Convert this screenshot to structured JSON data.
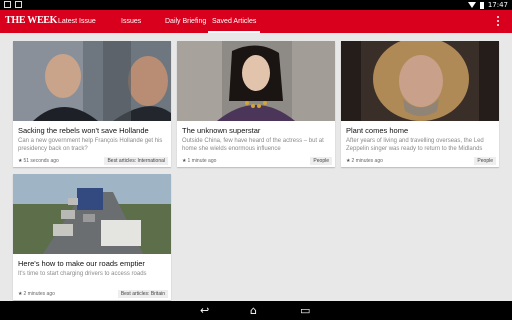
{
  "status": {
    "time": "17:47"
  },
  "app": {
    "logo": "THE WEEK"
  },
  "tabs": [
    {
      "label": "Latest Issue"
    },
    {
      "label": "Issues"
    },
    {
      "label": "Daily Briefing"
    },
    {
      "label": "Saved Articles",
      "active": true
    }
  ],
  "articles": [
    {
      "title": "Sacking the rebels won't save Hollande",
      "summary": "Can a new government help François Hollande get his presidency back on track?",
      "time": "51 seconds ago",
      "tag": "Best articles: International"
    },
    {
      "title": "The unknown superstar",
      "summary": "Outside China, few have heard of the actress – but at home she wields enormous influence",
      "time": "1 minute ago",
      "tag": "People"
    },
    {
      "title": "Plant comes home",
      "summary": "After years of living and travelling overseas, the Led Zeppelin singer was ready to return to the Midlands",
      "time": "2 minutes ago",
      "tag": "People"
    },
    {
      "title": "Here's how to make our roads emptier",
      "summary": "It's time to start charging drivers to access roads",
      "time": "2 minutes ago",
      "tag": "Best articles: Britain"
    }
  ],
  "colors": {
    "brand": "#d9001e",
    "background": "#e8e8e8"
  }
}
